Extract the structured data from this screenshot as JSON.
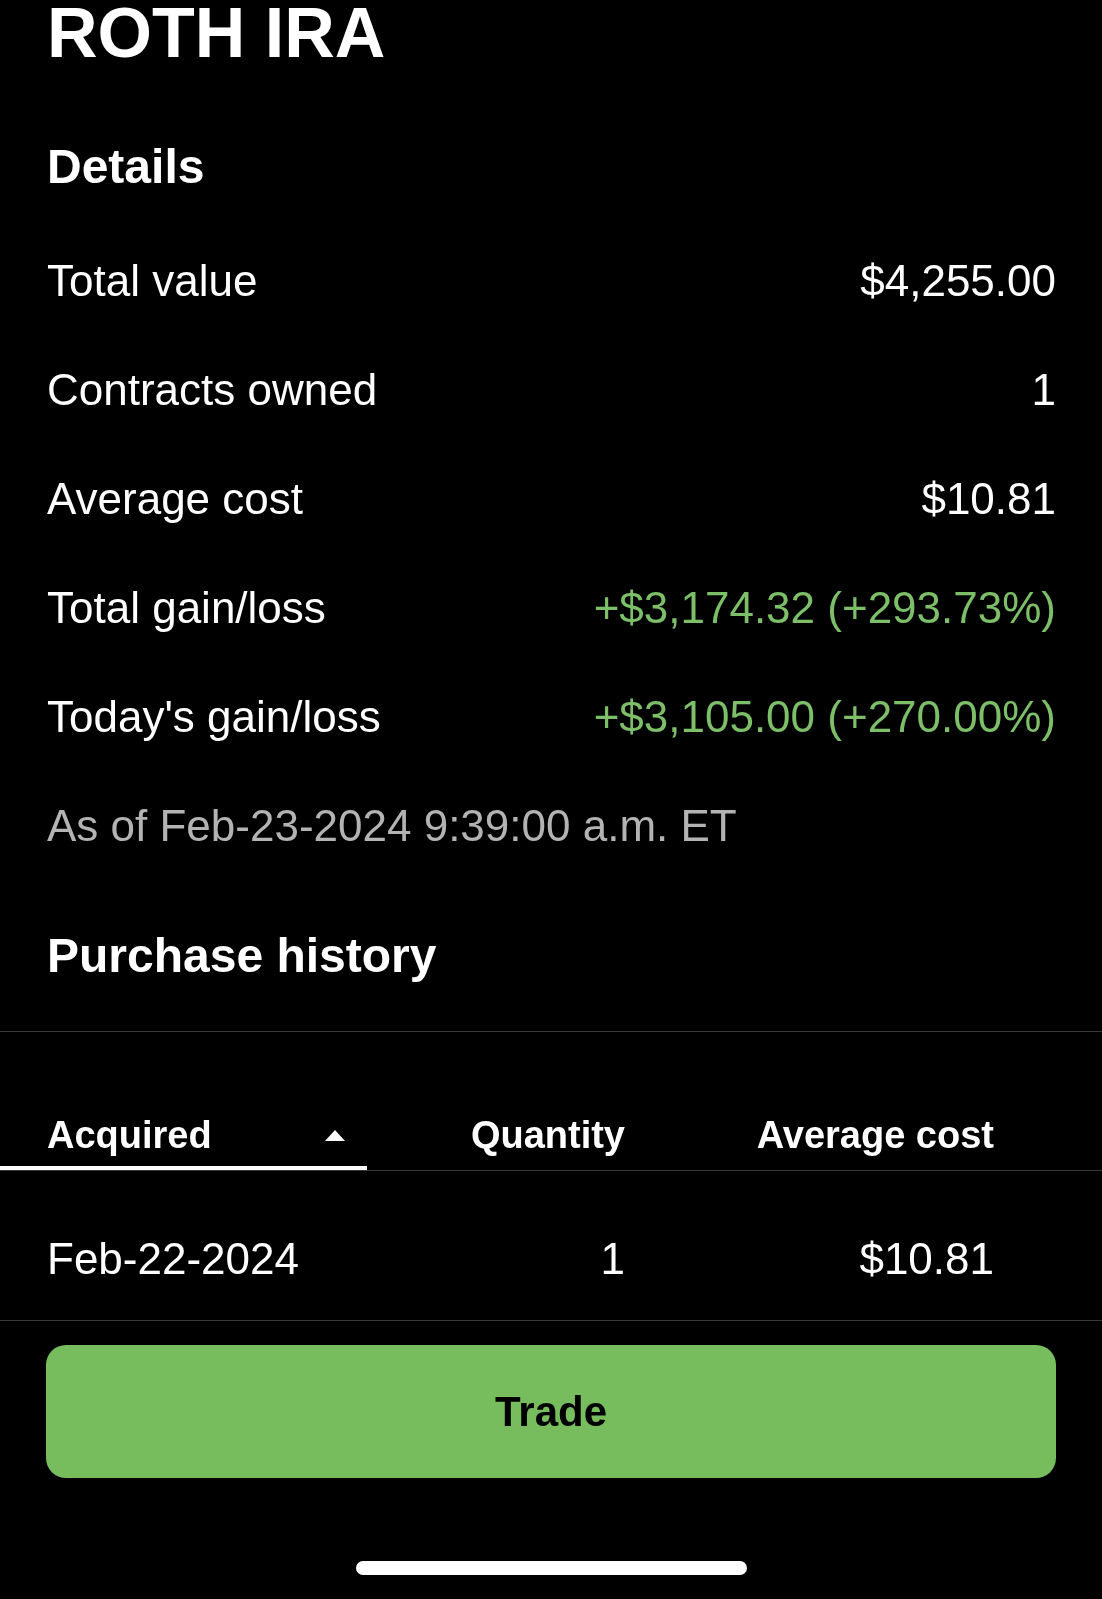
{
  "header": {
    "title": "ROTH IRA"
  },
  "details": {
    "heading": "Details",
    "rows": [
      {
        "label": "Total value",
        "value": "$4,255.00",
        "kind": "plain"
      },
      {
        "label": "Contracts owned",
        "value": "1",
        "kind": "plain"
      },
      {
        "label": "Average cost",
        "value": "$10.81",
        "kind": "plain"
      },
      {
        "label": "Total gain/loss",
        "value": "+$3,174.32 (+293.73%)",
        "kind": "gain"
      },
      {
        "label": "Today's gain/loss",
        "value": "+$3,105.00 (+270.00%)",
        "kind": "gain"
      }
    ],
    "as_of": "As of Feb-23-2024 9:39:00 a.m. ET"
  },
  "purchase_history": {
    "heading": "Purchase history",
    "columns": [
      {
        "label": "Acquired",
        "selected": true,
        "sorted": true
      },
      {
        "label": "Quantity",
        "selected": false,
        "sorted": false
      },
      {
        "label": "Average cost",
        "selected": false,
        "sorted": false
      }
    ],
    "rows": [
      [
        "Feb-22-2024",
        "1",
        "$10.81"
      ]
    ]
  },
  "trade_button": {
    "label": "Trade"
  }
}
